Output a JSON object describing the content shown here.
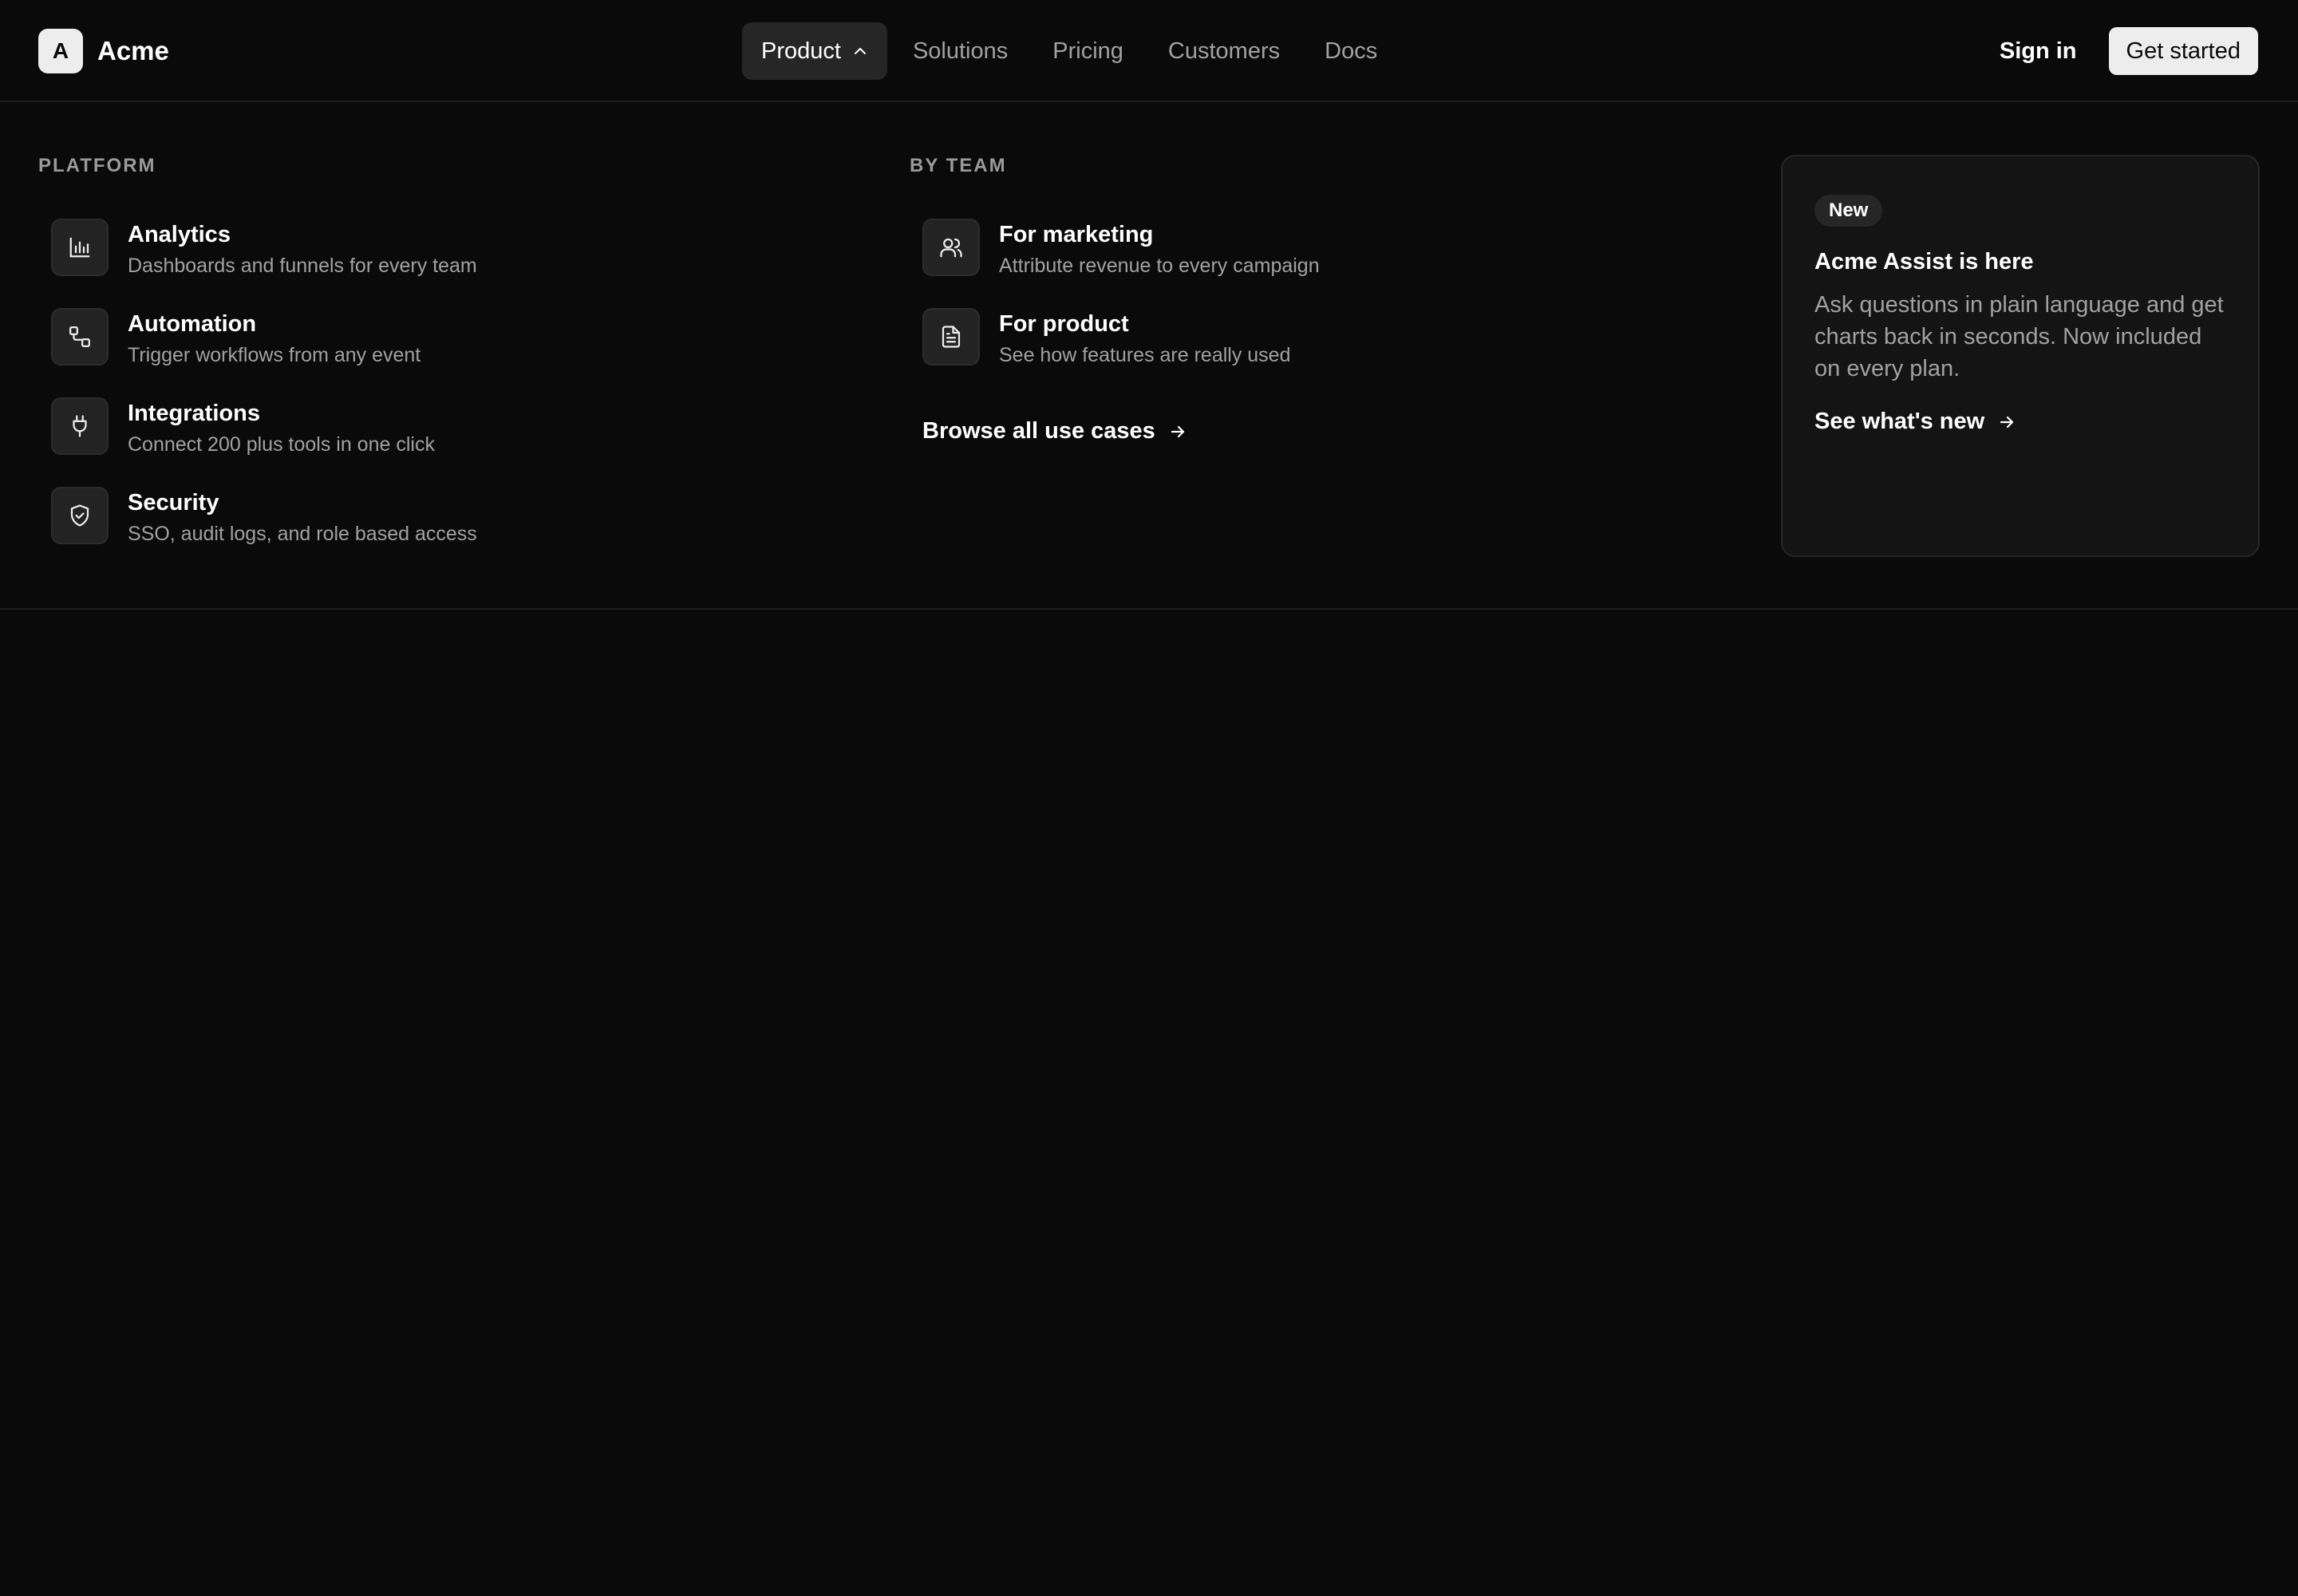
{
  "brand": {
    "mark": "A",
    "name": "Acme"
  },
  "nav": {
    "items": [
      {
        "label": "Product",
        "active": true
      },
      {
        "label": "Solutions"
      },
      {
        "label": "Pricing"
      },
      {
        "label": "Customers"
      },
      {
        "label": "Docs"
      }
    ]
  },
  "header": {
    "signin_label": "Sign in",
    "cta_label": "Get started"
  },
  "panel": {
    "platform": {
      "label": "PLATFORM",
      "items": [
        {
          "title": "Analytics",
          "desc": "Dashboards and funnels for every team",
          "icon": "bar-chart-icon"
        },
        {
          "title": "Automation",
          "desc": "Trigger workflows from any event",
          "icon": "workflow-icon"
        },
        {
          "title": "Integrations",
          "desc": "Connect 200 plus tools in one click",
          "icon": "plug-icon"
        },
        {
          "title": "Security",
          "desc": "SSO, audit logs, and role based access",
          "icon": "shield-check-icon"
        }
      ]
    },
    "by_team": {
      "label": "BY TEAM",
      "items": [
        {
          "title": "For marketing",
          "desc": "Attribute revenue to every campaign",
          "icon": "users-icon"
        },
        {
          "title": "For product",
          "desc": "See how features are really used",
          "icon": "document-icon"
        }
      ],
      "browse_label": "Browse all use cases"
    },
    "promo": {
      "badge": "New",
      "title": "Acme Assist is here",
      "body": "Ask questions in plain language and get charts back in seconds. Now included on every plan.",
      "link_label": "See what's new"
    }
  },
  "colors": {
    "background": "#0a0a0a",
    "surface": "#141414",
    "accent": "#ededed"
  }
}
